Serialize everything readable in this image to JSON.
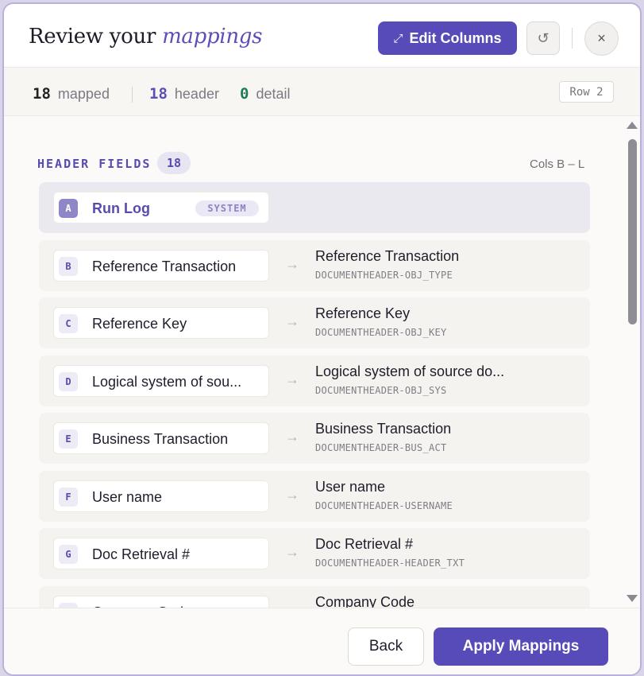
{
  "header": {
    "title_plain": "Review your",
    "title_accent": "mappings",
    "edit_columns_label": "Edit Columns",
    "edit_icon": "expand-arrows-icon",
    "reset_icon": "undo-icon",
    "close_icon": "close-icon",
    "reset_glyph": "↺",
    "close_glyph": "×",
    "edit_glyph": "⤢"
  },
  "stats": {
    "mapped_count": "18",
    "mapped_label": "mapped",
    "header_count": "18",
    "header_label": "header",
    "detail_count": "0",
    "detail_label": "detail",
    "row_badge": "Row 2"
  },
  "section": {
    "title": "HEADER FIELDS",
    "count": "18",
    "cols_range": "Cols B – L"
  },
  "rows": [
    {
      "letter": "A",
      "source": "Run Log",
      "badge": "SYSTEM",
      "target_title": "",
      "target_code": "",
      "arrow": ""
    },
    {
      "letter": "B",
      "source": "Reference Transaction",
      "badge": "",
      "target_title": "Reference Transaction",
      "target_code": "DOCUMENTHEADER-OBJ_TYPE",
      "arrow": "→"
    },
    {
      "letter": "C",
      "source": "Reference Key",
      "badge": "",
      "target_title": "Reference Key",
      "target_code": "DOCUMENTHEADER-OBJ_KEY",
      "arrow": "→"
    },
    {
      "letter": "D",
      "source": "Logical system of sou...",
      "badge": "",
      "target_title": "Logical system of source do...",
      "target_code": "DOCUMENTHEADER-OBJ_SYS",
      "arrow": "→"
    },
    {
      "letter": "E",
      "source": "Business Transaction",
      "badge": "",
      "target_title": "Business Transaction",
      "target_code": "DOCUMENTHEADER-BUS_ACT",
      "arrow": "→"
    },
    {
      "letter": "F",
      "source": "User name",
      "badge": "",
      "target_title": "User name",
      "target_code": "DOCUMENTHEADER-USERNAME",
      "arrow": "→"
    },
    {
      "letter": "G",
      "source": "Doc Retrieval #",
      "badge": "",
      "target_title": "Doc Retrieval #",
      "target_code": "DOCUMENTHEADER-HEADER_TXT",
      "arrow": "→"
    },
    {
      "letter": "H",
      "source": "Company Code",
      "badge": "",
      "target_title": "Company Code",
      "target_code": "",
      "arrow": "→"
    }
  ],
  "footer": {
    "back_label": "Back",
    "apply_label": "Apply Mappings"
  },
  "colors": {
    "accent": "#564bb8",
    "accent_text": "#5b4fb6",
    "detail_green": "#1e7b59"
  }
}
